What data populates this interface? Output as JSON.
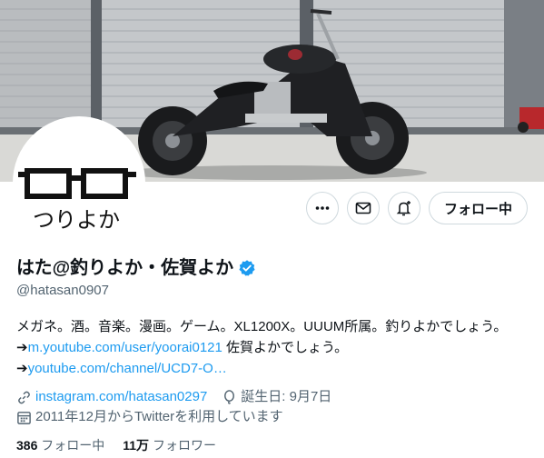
{
  "banner": {
    "description_icon": "motorcycle-banner-image"
  },
  "avatar": {
    "icon": "glasses-logo",
    "text": "つりよか"
  },
  "actions": {
    "more_icon": "more-dots-icon",
    "message_icon": "mail-icon",
    "notify_icon": "bell-plus-icon",
    "follow_label": "フォロー中"
  },
  "profile": {
    "display_name": "はた@釣りよか・佐賀よか",
    "verified_icon": "verified-badge-icon",
    "handle": "@hatasan0907"
  },
  "bio": {
    "line1": "メガネ。酒。音楽。漫画。ゲーム。XL1200X。UUUM所属。釣りよかでしょう。",
    "line2_prefix": "➔",
    "line2_link": "m.youtube.com/user/yoorai0121",
    "line2_suffix": " 佐賀よかでしょう。",
    "line3_prefix": "➔",
    "line3_link": "youtube.com/channel/UCD7-O…"
  },
  "meta": {
    "website": "instagram.com/hatasan0297",
    "birthday": "誕生日: 9月7日",
    "joined": "2011年12月からTwitterを利用しています"
  },
  "stats": {
    "following_count": "386",
    "following_label": "フォロー中",
    "followers_count": "11万",
    "followers_label": "フォロワー"
  },
  "colors": {
    "link": "#1d9bf0",
    "secondary": "#536471",
    "text": "#0f1419"
  }
}
